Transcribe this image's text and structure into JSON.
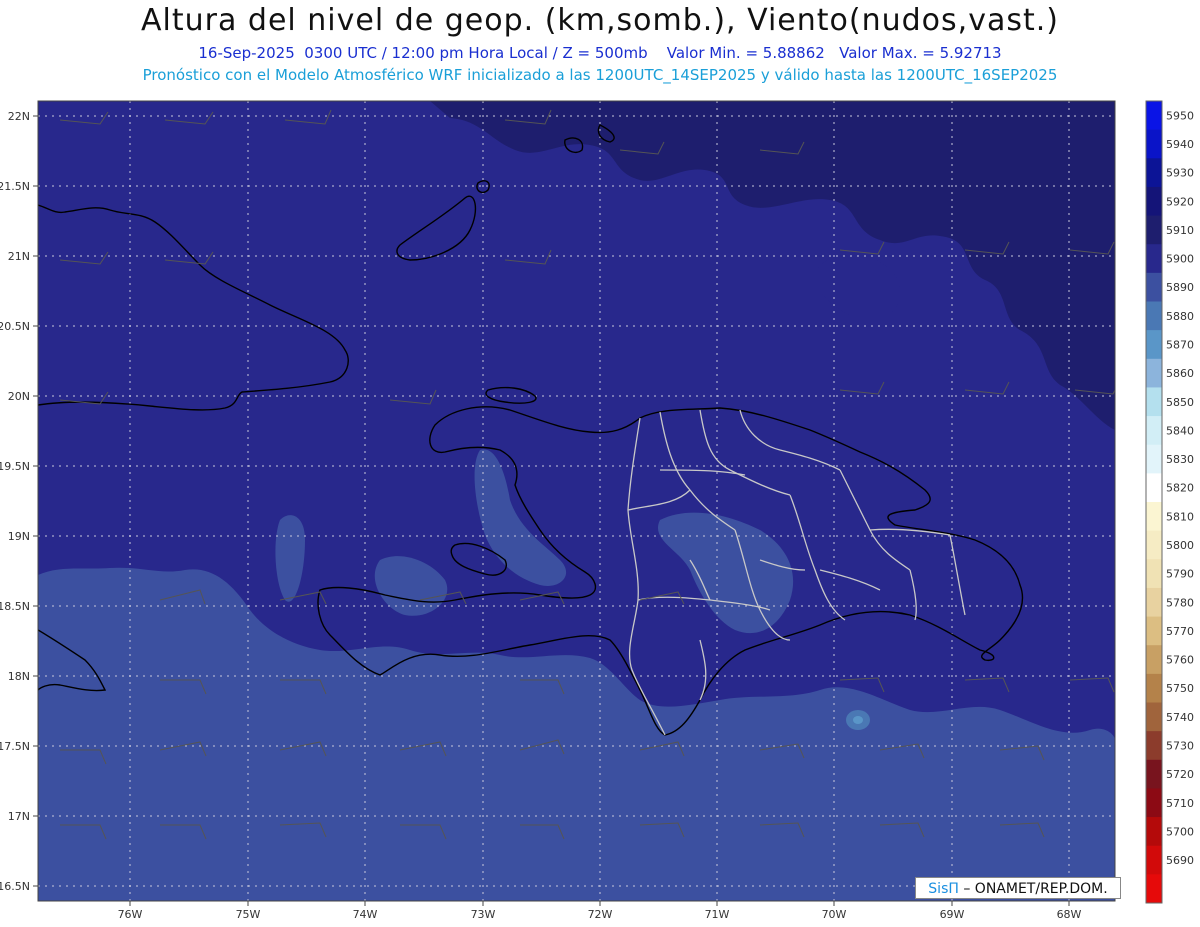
{
  "header": {
    "title": "Altura del nivel de geop. (km,somb.), Viento(nudos,vast.)",
    "subtitle_date": "16-Sep-2025  0300 UTC / 12:00 pm Hora Local / Z = 500mb",
    "subtitle_min": "Valor Min. = 5.88862",
    "subtitle_max": "Valor Max. = 5.92713",
    "subtitle_model": "Pronóstico con el Modelo Atmosférico WRF inicializado a las 1200UTC_14SEP2025 y válido hasta las  1200UTC_16SEP2025"
  },
  "axes": {
    "lat_labels": [
      "22N",
      "21.5N",
      "21N",
      "20.5N",
      "20N",
      "19.5N",
      "19N",
      "18.5N",
      "18N",
      "17.5N",
      "17N",
      "16.5N"
    ],
    "lon_labels": [
      "76W",
      "75W",
      "74W",
      "73W",
      "72W",
      "71W",
      "70W",
      "69W",
      "68W"
    ]
  },
  "colorbar": {
    "levels": [
      "5950",
      "5940",
      "5930",
      "5920",
      "5910",
      "5900",
      "5890",
      "5880",
      "5870",
      "5860",
      "5850",
      "5840",
      "5830",
      "5820",
      "5810",
      "5800",
      "5790",
      "5780",
      "5770",
      "5760",
      "5750",
      "5740",
      "5730",
      "5720",
      "5710",
      "5700",
      "5690"
    ],
    "colors": [
      "#0a14e6",
      "#0a14c8",
      "#0c1496",
      "#141478",
      "#1e1e6e",
      "#28288c",
      "#3c50a0",
      "#4a78b4",
      "#5a96c8",
      "#8cb4dc",
      "#b4e0ee",
      "#d2eef6",
      "#e2f4fa",
      "#ffffff",
      "#fbf5d2",
      "#f6ecc4",
      "#f0e2b4",
      "#e8d2a0",
      "#dcbe82",
      "#c8a064",
      "#b4824a",
      "#a0643c",
      "#8c3c2c",
      "#78141e",
      "#8c0a14",
      "#b40a0a",
      "#d20a0a",
      "#e60a0a"
    ]
  },
  "footer": {
    "logo_prefix": "SisΠ",
    "logo_text": " – ONAMET/REP.DOM."
  }
}
